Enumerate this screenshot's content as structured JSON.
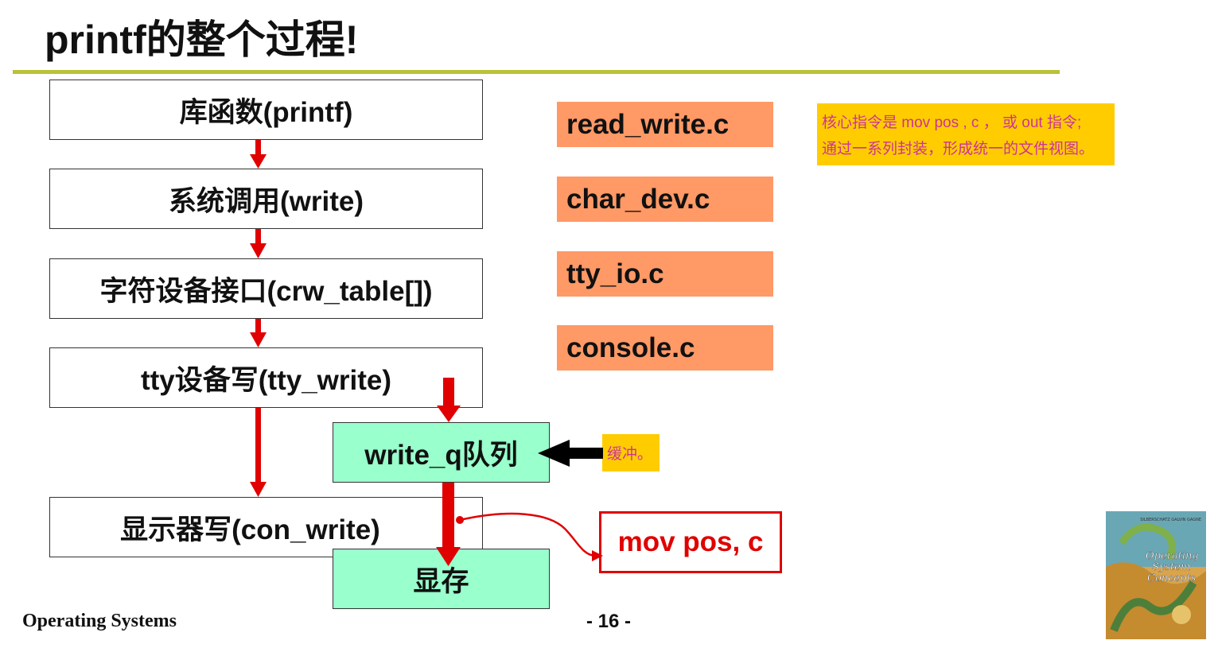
{
  "title": "printf的整个过程!",
  "flow": {
    "steps": [
      "库函数(printf)",
      "系统调用(write)",
      "字符设备接口(crw_table[])",
      "tty设备写(tty_write)",
      "显示器写(con_write)"
    ],
    "queue": "write_q队列",
    "vram": "显存"
  },
  "files": [
    "read_write.c",
    "char_dev.c",
    "tty_io.c",
    "console.c"
  ],
  "notes": {
    "core_line1": "核心指令是 mov pos , c ，  或 out 指令;",
    "core_line2": "通过一系列封装，形成统一的文件视图。",
    "buffer": "缓冲。"
  },
  "mov_label": "mov pos, c",
  "book": {
    "authors": "SILBERSCHATZ GALVIN GAGNE",
    "title_line1": "Operating",
    "title_line2": "System",
    "title_line3": "Concepts"
  },
  "footer": {
    "course": "Operating Systems",
    "page": "- 16 -"
  },
  "colors": {
    "title_rule": "#b9c23a",
    "file_box": "#ff9966",
    "green_box": "#99ffcc",
    "note_bg": "#ffcc00",
    "note_text": "#cc3399",
    "arrow_red": "#e00000"
  }
}
